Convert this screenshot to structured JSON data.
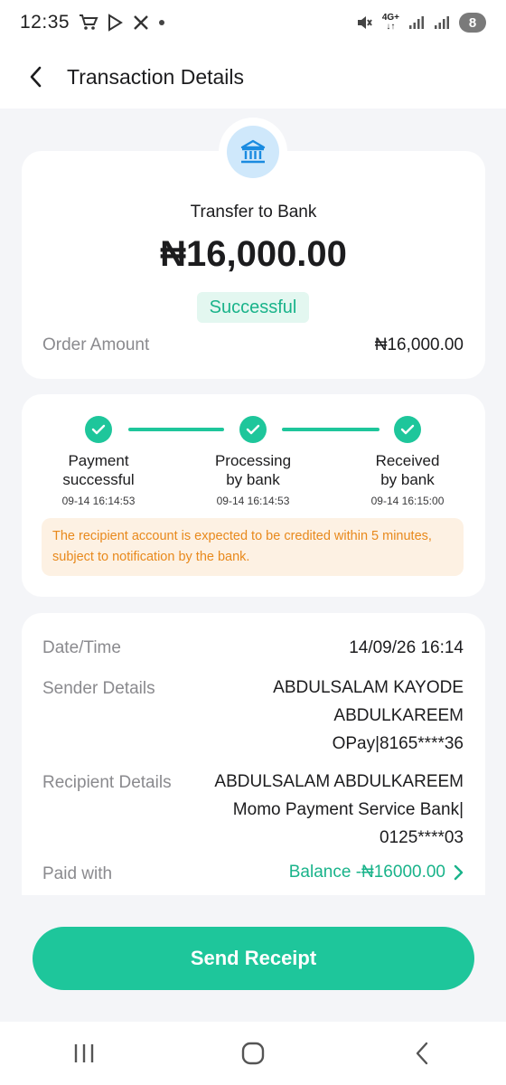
{
  "status_bar": {
    "time": "12:35",
    "network_label": "4G+",
    "battery": "8"
  },
  "header": {
    "title": "Transaction Details"
  },
  "summary": {
    "type": "Transfer to Bank",
    "amount": "₦16,000.00",
    "status": "Successful",
    "order_label": "Order Amount",
    "order_value": "₦16,000.00"
  },
  "progress": {
    "steps": [
      {
        "label_line1": "Payment",
        "label_line2": "successful",
        "time": "09-14 16:14:53"
      },
      {
        "label_line1": "Processing",
        "label_line2": "by bank",
        "time": "09-14 16:14:53"
      },
      {
        "label_line1": "Received",
        "label_line2": "by bank",
        "time": "09-14 16:15:00"
      }
    ],
    "notice_line1": "The recipient account is expected to be credited within 5 minutes,",
    "notice_line2": "subject to notification by the bank."
  },
  "details": {
    "datetime_label": "Date/Time",
    "datetime_value": "14/09/26 16:14",
    "sender_label": "Sender Details",
    "sender_line1": "ABDULSALAM KAYODE",
    "sender_line2": "ABDULKAREEM",
    "sender_line3": "OPay|8165****36",
    "recipient_label": "Recipient Details",
    "recipient_line1": "ABDULSALAM ABDULKAREEM",
    "recipient_line2": "Momo Payment Service Bank|",
    "recipient_line3": "0125****03",
    "paid_label": "Paid with",
    "paid_value": "Balance -₦16000.00"
  },
  "actions": {
    "send_receipt": "Send Receipt"
  },
  "icons": {
    "back": "chevron-left-icon",
    "bank": "bank-icon",
    "step": "check-icon",
    "paid_arrow": "chevron-right-icon",
    "nav_recents": "recents-icon",
    "nav_home": "home-icon",
    "nav_back": "back-icon"
  },
  "colors": {
    "accent": "#1ec69b",
    "success_text": "#19b38a",
    "notice_text": "#e8891c",
    "notice_bg": "#fdf1e3",
    "bank_icon": "#1a8be0"
  }
}
